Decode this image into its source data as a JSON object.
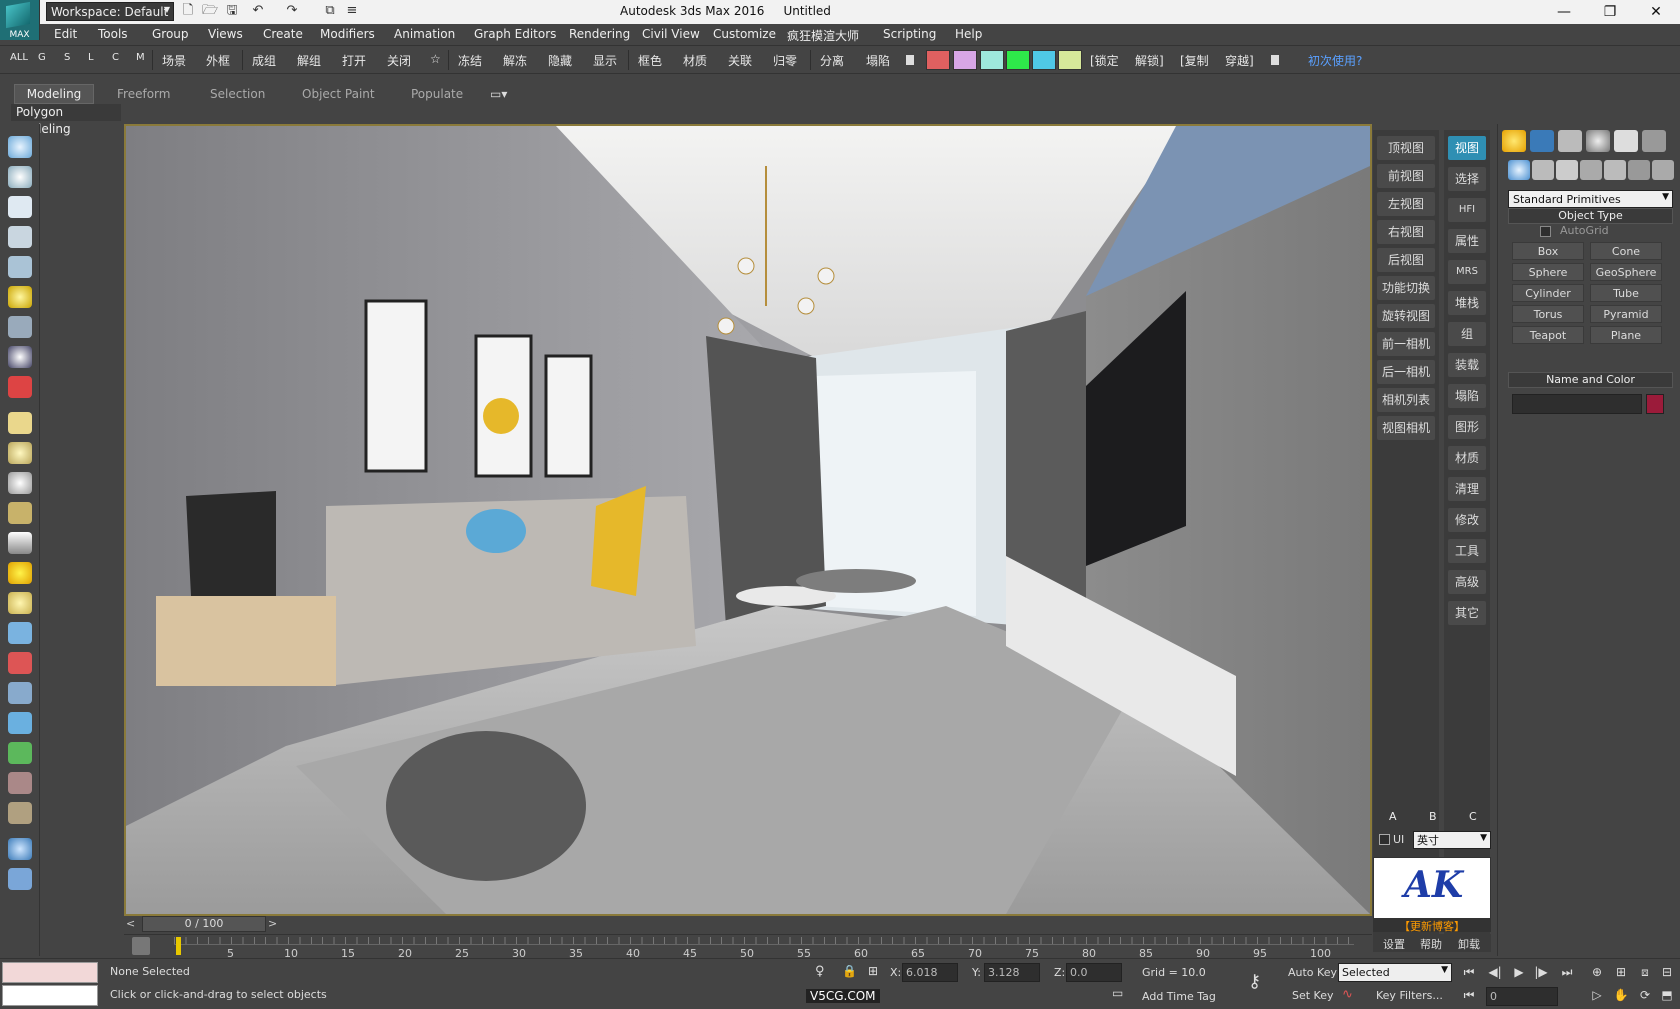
{
  "title_bar": {
    "logo_text": "MAX",
    "workspace": "Workspace: Default",
    "window_title": "Autodesk 3ds Max 2016",
    "document": "Untitled"
  },
  "menus": [
    "Edit",
    "Tools",
    "Group",
    "Views",
    "Create",
    "Modifiers",
    "Animation",
    "Graph Editors",
    "Rendering",
    "Civil View",
    "Customize",
    "疯狂模渲大师",
    "Scripting",
    "Help"
  ],
  "toolbar": {
    "filters": [
      "ALL",
      "G",
      "S",
      "L",
      "C",
      "M"
    ],
    "group1": [
      "场景",
      "外框"
    ],
    "group2": [
      "成组",
      "解组",
      "打开",
      "关闭",
      "☆"
    ],
    "group3": [
      "冻结",
      "解冻",
      "隐藏",
      "显示"
    ],
    "group4": [
      "框色",
      "材质",
      "关联",
      "归零"
    ],
    "group5": [
      "分离",
      "塌陷"
    ],
    "swatch_colors": [
      "#e06060",
      "#d7a6e6",
      "#9ee8dc",
      "#2ee84a",
      "#4fc8e6",
      "#d6e89a"
    ],
    "group6": [
      "[锁定",
      "解锁]",
      "[复制",
      "穿越]"
    ],
    "help_link": "初次使用?"
  },
  "ribbon": {
    "tabs": [
      "Modeling",
      "Freeform",
      "Selection",
      "Object Paint",
      "Populate"
    ],
    "panel_label": "Polygon Modeling"
  },
  "viewport_menu": {
    "col1": [
      "顶视图",
      "前视图",
      "左视图",
      "右视图",
      "后视图",
      "功能切换",
      "旋转视图",
      "前一相机",
      "后一相机",
      "相机列表",
      "视图相机"
    ],
    "col2": [
      "视图",
      "选择",
      "HFI",
      "属性",
      "MRS",
      "堆栈",
      "组",
      "装载",
      "塌陷",
      "图形",
      "材质",
      "清理",
      "修改",
      "工具",
      "高级",
      "其它"
    ],
    "abc": [
      "A",
      "B",
      "C"
    ],
    "ui_label": "UI",
    "unit": "英寸",
    "logo_text": "AK",
    "logo_sub": "【更新博客】",
    "bottom": [
      "设置",
      "帮助",
      "卸载"
    ]
  },
  "command_panel": {
    "dropdown": "Standard Primitives",
    "object_type_header": "Object Type",
    "autogrid": "AutoGrid",
    "buttons": [
      "Box",
      "Cone",
      "Sphere",
      "GeoSphere",
      "Cylinder",
      "Tube",
      "Torus",
      "Pyramid",
      "Teapot",
      "Plane"
    ],
    "name_color_header": "Name and Color",
    "object_color": "#9b1b3a"
  },
  "time_slider": {
    "label": "0 / 100",
    "frame_current": 0,
    "frame_total": 100,
    "ticks": [
      "5",
      "10",
      "15",
      "20",
      "25",
      "30",
      "35",
      "40",
      "45",
      "50",
      "55",
      "60",
      "65",
      "70",
      "75",
      "80",
      "85",
      "90",
      "95",
      "100"
    ]
  },
  "status": {
    "selection": "None Selected",
    "prompt": "Click or click-and-drag to select objects",
    "x_label": "X:",
    "x_value": "6.018",
    "y_label": "Y:",
    "y_value": "3.128",
    "z_label": "Z:",
    "z_value": "0.0",
    "grid": "Grid = 10.0",
    "add_time_tag": "Add Time Tag",
    "auto_key": "Auto Key",
    "set_key": "Set Key",
    "key_mode": "Selected",
    "key_filters": "Key Filters...",
    "frame_field": "0",
    "watermark": "V5CG.COM"
  }
}
